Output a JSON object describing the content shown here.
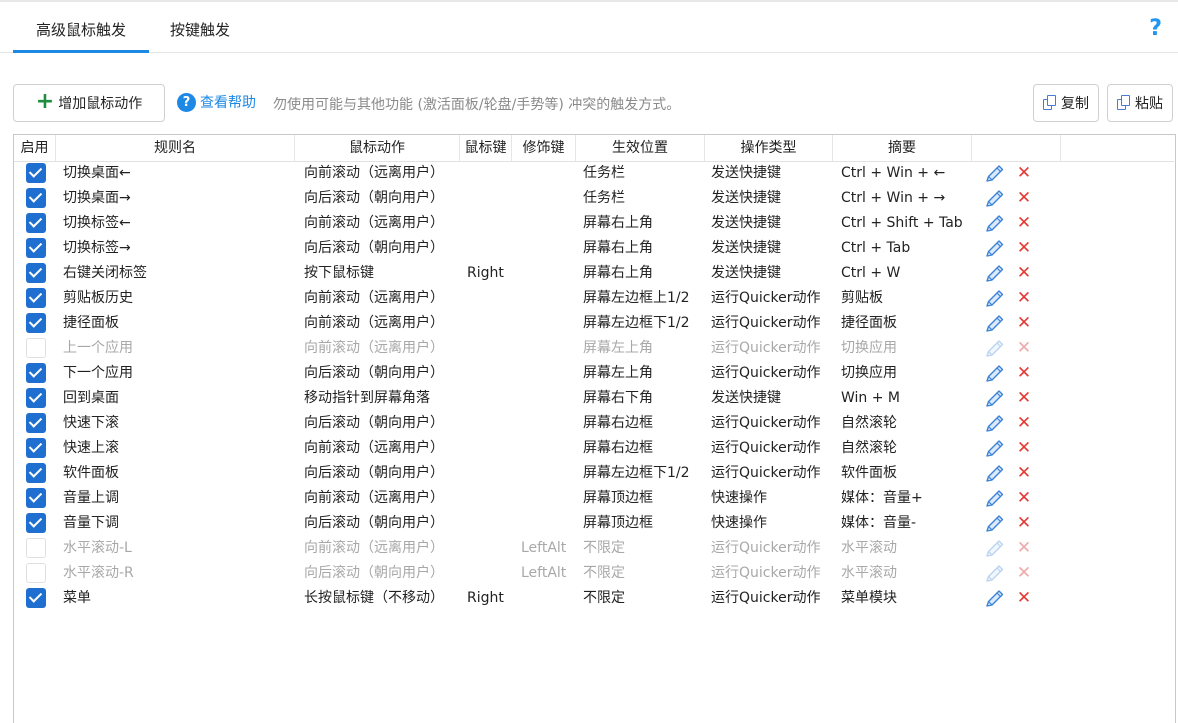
{
  "tabs": [
    {
      "label": "高级鼠标触发",
      "active": true
    },
    {
      "label": "按键触发",
      "active": false
    }
  ],
  "help_icon": "?",
  "toolbar": {
    "add_label": "增加鼠标动作",
    "help_label": "查看帮助",
    "note": "勿使用可能与其他功能 (激活面板/轮盘/手势等) 冲突的触发方式。",
    "copy_label": "复制",
    "paste_label": "粘贴"
  },
  "columns": [
    "启用",
    "规则名",
    "鼠标动作",
    "鼠标键",
    "修饰键",
    "生效位置",
    "操作类型",
    "摘要"
  ],
  "rows": [
    {
      "enabled": true,
      "name": "切换桌面←",
      "action": "向前滚动（远离用户）",
      "button": "",
      "modifier": "",
      "position": "任务栏",
      "optype": "发送快捷键",
      "summary": "Ctrl + Win + ←"
    },
    {
      "enabled": true,
      "name": "切换桌面→",
      "action": "向后滚动（朝向用户）",
      "button": "",
      "modifier": "",
      "position": "任务栏",
      "optype": "发送快捷键",
      "summary": "Ctrl + Win + →"
    },
    {
      "enabled": true,
      "name": "切换标签←",
      "action": "向前滚动（远离用户）",
      "button": "",
      "modifier": "",
      "position": "屏幕右上角",
      "optype": "发送快捷键",
      "summary": "Ctrl + Shift + Tab"
    },
    {
      "enabled": true,
      "name": "切换标签→",
      "action": "向后滚动（朝向用户）",
      "button": "",
      "modifier": "",
      "position": "屏幕右上角",
      "optype": "发送快捷键",
      "summary": "Ctrl + Tab"
    },
    {
      "enabled": true,
      "name": "右键关闭标签",
      "action": "按下鼠标键",
      "button": "Right",
      "modifier": "",
      "position": "屏幕右上角",
      "optype": "发送快捷键",
      "summary": "Ctrl + W"
    },
    {
      "enabled": true,
      "name": "剪贴板历史",
      "action": "向前滚动（远离用户）",
      "button": "",
      "modifier": "",
      "position": "屏幕左边框上1/2",
      "optype": "运行Quicker动作",
      "summary": "剪贴板"
    },
    {
      "enabled": true,
      "name": "捷径面板",
      "action": "向前滚动（远离用户）",
      "button": "",
      "modifier": "",
      "position": "屏幕左边框下1/2",
      "optype": "运行Quicker动作",
      "summary": "捷径面板"
    },
    {
      "enabled": false,
      "name": "上一个应用",
      "action": "向前滚动（远离用户）",
      "button": "",
      "modifier": "",
      "position": "屏幕左上角",
      "optype": "运行Quicker动作",
      "summary": "切换应用"
    },
    {
      "enabled": true,
      "name": "下一个应用",
      "action": "向后滚动（朝向用户）",
      "button": "",
      "modifier": "",
      "position": "屏幕左上角",
      "optype": "运行Quicker动作",
      "summary": "切换应用"
    },
    {
      "enabled": true,
      "name": "回到桌面",
      "action": "移动指针到屏幕角落",
      "button": "",
      "modifier": "",
      "position": "屏幕右下角",
      "optype": "发送快捷键",
      "summary": "Win + M"
    },
    {
      "enabled": true,
      "name": "快速下滚",
      "action": "向后滚动（朝向用户）",
      "button": "",
      "modifier": "",
      "position": "屏幕右边框",
      "optype": "运行Quicker动作",
      "summary": "自然滚轮"
    },
    {
      "enabled": true,
      "name": "快速上滚",
      "action": "向前滚动（远离用户）",
      "button": "",
      "modifier": "",
      "position": "屏幕右边框",
      "optype": "运行Quicker动作",
      "summary": "自然滚轮"
    },
    {
      "enabled": true,
      "name": "软件面板",
      "action": "向后滚动（朝向用户）",
      "button": "",
      "modifier": "",
      "position": "屏幕左边框下1/2",
      "optype": "运行Quicker动作",
      "summary": "软件面板"
    },
    {
      "enabled": true,
      "name": "音量上调",
      "action": "向前滚动（远离用户）",
      "button": "",
      "modifier": "",
      "position": "屏幕顶边框",
      "optype": "快速操作",
      "summary": "媒体：音量+"
    },
    {
      "enabled": true,
      "name": "音量下调",
      "action": "向后滚动（朝向用户）",
      "button": "",
      "modifier": "",
      "position": "屏幕顶边框",
      "optype": "快速操作",
      "summary": "媒体：音量-"
    },
    {
      "enabled": false,
      "name": "水平滚动-L",
      "action": "向前滚动（远离用户）",
      "button": "",
      "modifier": "LeftAlt",
      "position": "不限定",
      "optype": "运行Quicker动作",
      "summary": "水平滚动"
    },
    {
      "enabled": false,
      "name": "水平滚动-R",
      "action": "向后滚动（朝向用户）",
      "button": "",
      "modifier": "LeftAlt",
      "position": "不限定",
      "optype": "运行Quicker动作",
      "summary": "水平滚动"
    },
    {
      "enabled": true,
      "name": "菜单",
      "action": "长按鼠标键（不移动）",
      "button": "Right",
      "modifier": "",
      "position": "不限定",
      "optype": "运行Quicker动作",
      "summary": "菜单模块"
    }
  ],
  "icons": {
    "edit": "pencil-icon",
    "delete": "close-icon",
    "add": "plus-icon",
    "help": "question-icon",
    "copy": "copy-icon",
    "paste": "paste-icon"
  },
  "colors": {
    "accent": "#1e88e5",
    "checkbox": "#1f6fd0",
    "delete": "#e53935",
    "add": "#1e8e3e"
  }
}
